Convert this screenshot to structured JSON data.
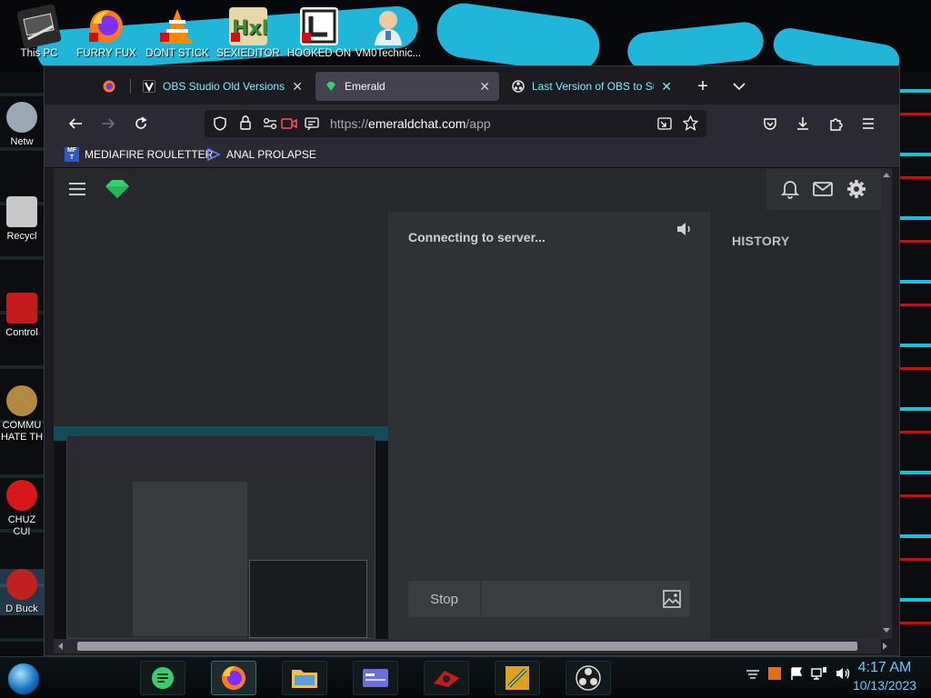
{
  "desktop": {
    "top_icons": [
      {
        "label": "This PC",
        "icon": "this-pc-icon"
      },
      {
        "label": "FURRY FUX",
        "icon": "firefox-shortcut-icon"
      },
      {
        "label": "DONT STICK",
        "icon": "vlc-cone-icon"
      },
      {
        "label": "SEXIEDITOR",
        "icon": "hxd-editor-icon"
      },
      {
        "label": "HOOKED ON",
        "icon": "app-shortcut-icon"
      },
      {
        "label": "VM0Technic...",
        "icon": "doctor-avatar-icon"
      }
    ],
    "left_icons": [
      {
        "label": "Netw",
        "icon": "network-icon"
      },
      {
        "label": "Recycl",
        "icon": "recycle-bin-icon"
      },
      {
        "label": "Control",
        "icon": "control-panel-icon"
      },
      {
        "label": "COMMU HATE TH",
        "icon": "money-bag-icon"
      },
      {
        "label": "CHUZ CUI",
        "icon": "red-creature-icon"
      },
      {
        "label": "D Buck",
        "icon": "bucket-icon"
      }
    ]
  },
  "browser": {
    "tabs": [
      {
        "label": "",
        "favicon": "firefox-icon",
        "active": false
      },
      {
        "label": "OBS Studio Old Versions Do",
        "favicon": "v-favicon",
        "active": false
      },
      {
        "label": "Emerald",
        "favicon": "emerald-gem-favicon",
        "active": true
      },
      {
        "label": "Last Version of OBS to Supp",
        "favicon": "obs-favicon",
        "active": false
      }
    ],
    "url": {
      "scheme": "https://",
      "host": "emeraldchat.com",
      "path": "/app"
    },
    "bookmarks": [
      {
        "label": "MEDIAFIRE ROULETTER",
        "favicon_text": "MF T"
      },
      {
        "label": "ANAL PROLAPSE",
        "favicon_text": ""
      }
    ]
  },
  "page": {
    "status": "Connecting to server...",
    "stop_label": "Stop",
    "history_label": "HISTORY"
  },
  "taskbar": {
    "apps": [
      "notes-app",
      "firefox",
      "file-explorer",
      "id-card-app",
      "red-app",
      "sword-app",
      "obs"
    ],
    "time": "4:17 AM",
    "date": "10/13/2023"
  },
  "colors": {
    "accent_green": "#2fd26e",
    "tab_link_blue": "#80ebff",
    "wallpaper_cyan": "#1fb6d9",
    "clock_blue": "#5ccfff"
  }
}
